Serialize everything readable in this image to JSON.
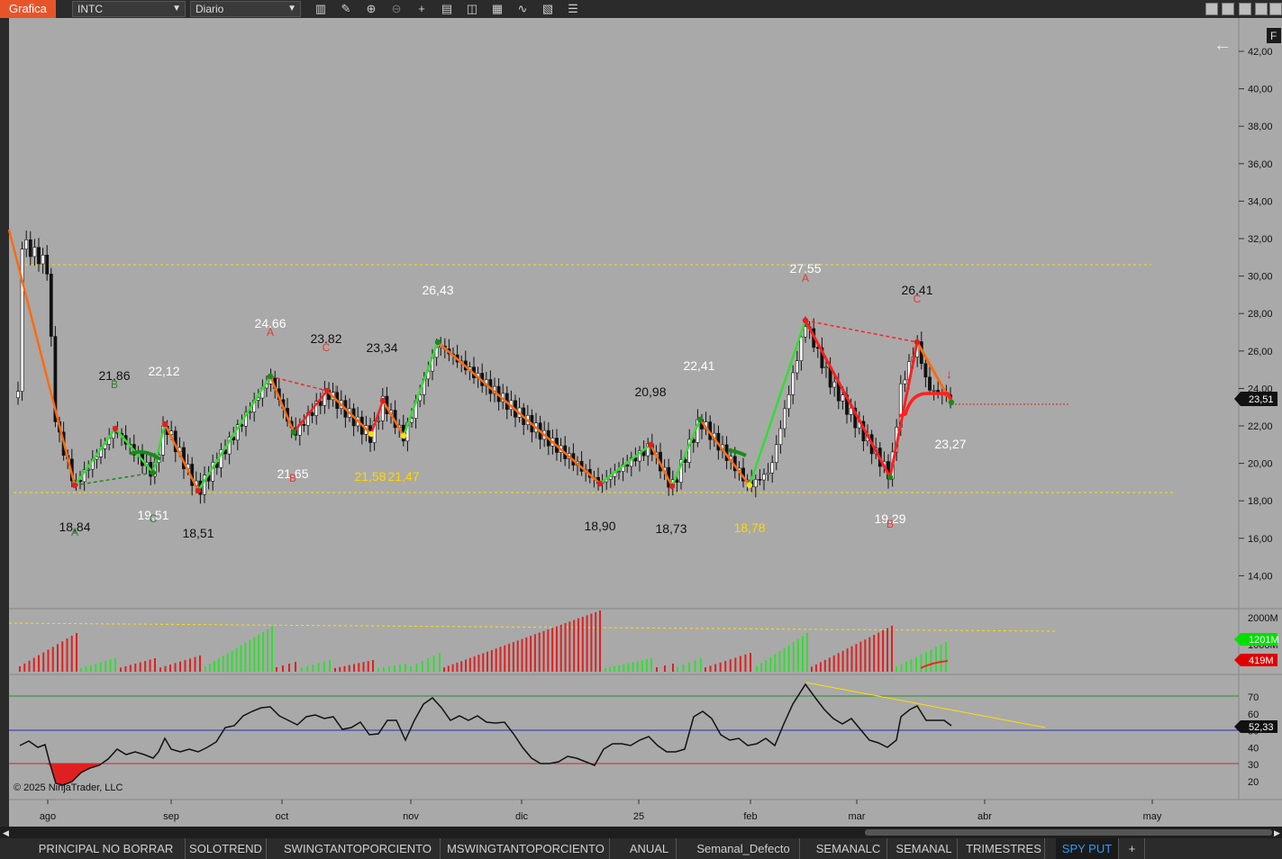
{
  "app_title": "Grafica",
  "instrument": "INTC",
  "timeframe": "Diario",
  "copyright": "© 2025 NinjaTrader, LLC",
  "f_button": "F",
  "tabs": [
    "PRINCIPAL NO BORRAR",
    "SOLOTREND",
    "SWINGTANTOPORCIENTO",
    "MSWINGTANTOPORCIENTO",
    "ANUAL",
    "Semanal_Defecto",
    "SEMANALC",
    "SEMANAL",
    "TRIMESTRES",
    "SPY PUT",
    "+"
  ],
  "active_tab": "SPY PUT",
  "price_axis": [
    "42,00",
    "40,00",
    "38,00",
    "36,00",
    "34,00",
    "32,00",
    "30,00",
    "28,00",
    "26,00",
    "24,00",
    "22,00",
    "20,00",
    "18,00",
    "16,00",
    "14,00"
  ],
  "current_price": "23,51",
  "volume_axis": [
    "2000M",
    "1000M"
  ],
  "volume_badges": [
    "1201M",
    "419M"
  ],
  "rsi_axis": [
    "70",
    "60",
    "50",
    "40",
    "30",
    "20"
  ],
  "rsi_value": "52,33",
  "time_axis": [
    "ago",
    "sep",
    "oct",
    "nov",
    "dic",
    "25",
    "feb",
    "mar",
    "abr",
    "may"
  ],
  "swing_labels": [
    {
      "t": "18,84",
      "c": "#111111"
    },
    {
      "t": "21,86",
      "c": "#111111"
    },
    {
      "t": "22,12",
      "c": "#ffffff"
    },
    {
      "t": "19,51",
      "c": "#ffffff"
    },
    {
      "t": "18,51",
      "c": "#111111"
    },
    {
      "t": "24.66",
      "c": "#ffffff"
    },
    {
      "t": "21.65",
      "c": "#ffffff"
    },
    {
      "t": "23.82",
      "c": "#111111"
    },
    {
      "t": "23,34",
      "c": "#111111"
    },
    {
      "t": "21,58",
      "c": "#ffd700"
    },
    {
      "t": "21,47",
      "c": "#ffd700"
    },
    {
      "t": "26,43",
      "c": "#ffffff"
    },
    {
      "t": "18,90",
      "c": "#111111"
    },
    {
      "t": "20,98",
      "c": "#111111"
    },
    {
      "t": "18,73",
      "c": "#111111"
    },
    {
      "t": "22,41",
      "c": "#ffffff"
    },
    {
      "t": "18,78",
      "c": "#ffd700"
    },
    {
      "t": "27.55",
      "c": "#ffffff"
    },
    {
      "t": "26,41",
      "c": "#111111"
    },
    {
      "t": "19.29",
      "c": "#ffffff"
    },
    {
      "t": "23,27",
      "c": "#ffffff"
    }
  ],
  "wave_letters": [
    {
      "t": "A",
      "c": "#2e7d32"
    },
    {
      "t": "B",
      "c": "#2e7d32"
    },
    {
      "t": "C",
      "c": "#2e7d32"
    },
    {
      "t": "A",
      "c": "#e53935"
    },
    {
      "t": "B",
      "c": "#e53935"
    },
    {
      "t": "C",
      "c": "#e53935"
    },
    {
      "t": "A",
      "c": "#e53935"
    },
    {
      "t": "B",
      "c": "#e53935"
    },
    {
      "t": "C",
      "c": "#e53935"
    }
  ],
  "colors": {
    "bg": "#a9a9a9",
    "up": "#2ee02e",
    "down": "#e02020",
    "leg_orange": "#ff6a10",
    "leg_green": "#33dd33",
    "leg_red": "#ff2020",
    "level": "#ffe000",
    "rsi_line": "#111111",
    "badge_green": "#00e000",
    "badge_red": "#e00000"
  }
}
